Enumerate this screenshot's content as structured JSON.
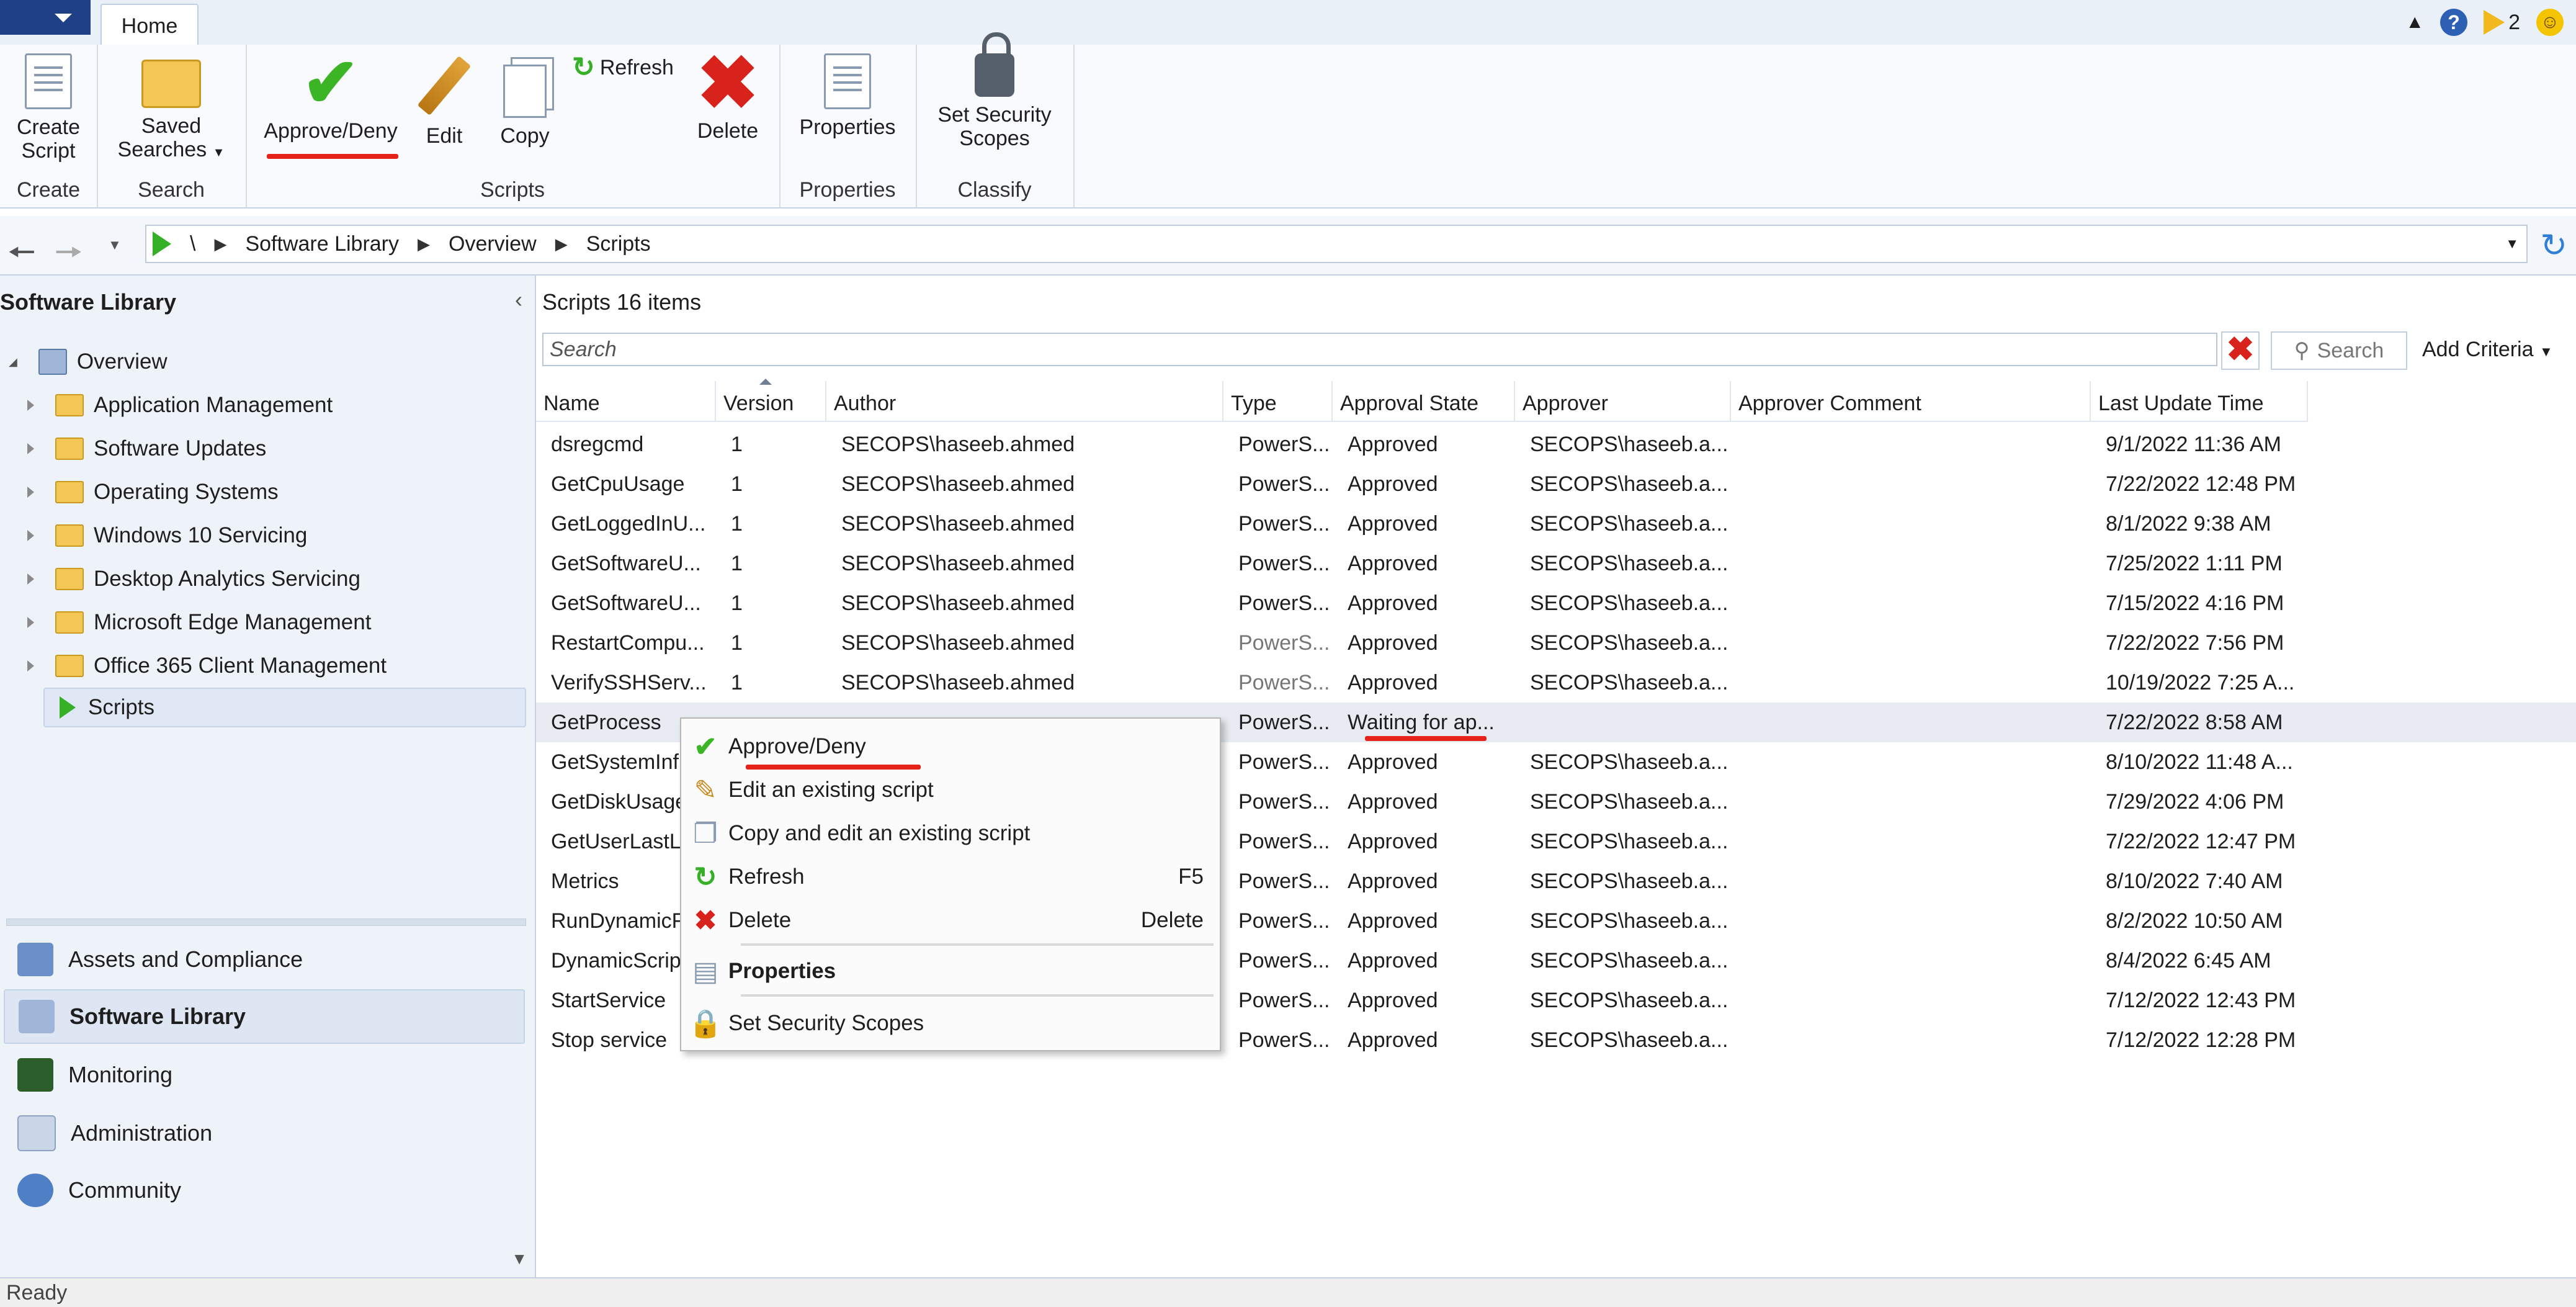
{
  "window": {
    "tab_home": "Home",
    "notification_count": "2",
    "help_glyph": "?"
  },
  "ribbon": {
    "create_script_line1": "Create",
    "create_script_line2": "Script",
    "saved_searches_line1": "Saved",
    "saved_searches_line2": "Searches",
    "approve_deny": "Approve/Deny",
    "edit": "Edit",
    "copy": "Copy",
    "refresh": "Refresh",
    "delete": "Delete",
    "properties": "Properties",
    "set_security_line1": "Set Security",
    "set_security_line2": "Scopes",
    "groups": {
      "create": "Create",
      "search": "Search",
      "scripts": "Scripts",
      "properties": "Properties",
      "classify": "Classify"
    }
  },
  "breadcrumb": {
    "root": "\\",
    "items": [
      "Software Library",
      "Overview",
      "Scripts"
    ]
  },
  "left_pane": {
    "title": "Software Library",
    "tree": [
      "Overview",
      "Application Management",
      "Software Updates",
      "Operating Systems",
      "Windows 10 Servicing",
      "Desktop Analytics Servicing",
      "Microsoft Edge Management",
      "Office 365 Client Management",
      "Scripts"
    ],
    "workspaces": [
      "Assets and Compliance",
      "Software Library",
      "Monitoring",
      "Administration",
      "Community"
    ]
  },
  "list": {
    "title": "Scripts 16 items",
    "search_placeholder": "Search",
    "search_button": "Search",
    "add_criteria": "Add Criteria",
    "columns": [
      "Name",
      "Version",
      "Author",
      "Type",
      "Approval State",
      "Approver",
      "Approver Comment",
      "Last Update Time"
    ],
    "rows": [
      [
        "dsregcmd",
        "1",
        "SECOPS\\haseeb.ahmed",
        "PowerS...",
        "Approved",
        "SECOPS\\haseeb.a...",
        "",
        "9/1/2022 11:36 AM"
      ],
      [
        "GetCpuUsage",
        "1",
        "SECOPS\\haseeb.ahmed",
        "PowerS...",
        "Approved",
        "SECOPS\\haseeb.a...",
        "",
        "7/22/2022 12:48 PM"
      ],
      [
        "GetLoggedInU...",
        "1",
        "SECOPS\\haseeb.ahmed",
        "PowerS...",
        "Approved",
        "SECOPS\\haseeb.a...",
        "",
        "8/1/2022 9:38 AM"
      ],
      [
        "GetSoftwareU...",
        "1",
        "SECOPS\\haseeb.ahmed",
        "PowerS...",
        "Approved",
        "SECOPS\\haseeb.a...",
        "",
        "7/25/2022 1:11 PM"
      ],
      [
        "GetSoftwareU...",
        "1",
        "SECOPS\\haseeb.ahmed",
        "PowerS...",
        "Approved",
        "SECOPS\\haseeb.a...",
        "",
        "7/15/2022 4:16 PM"
      ],
      [
        "RestartCompu...",
        "1",
        "SECOPS\\haseeb.ahmed",
        "PowerS...",
        "Approved",
        "SECOPS\\haseeb.a...",
        "",
        "7/22/2022 7:56 PM"
      ],
      [
        "VerifySSHServ...",
        "1",
        "SECOPS\\haseeb.ahmed",
        "PowerS...",
        "Approved",
        "SECOPS\\haseeb.a...",
        "",
        "10/19/2022 7:25 A..."
      ],
      [
        "GetProcess",
        "",
        "",
        "PowerS...",
        "Waiting for ap...",
        "",
        "",
        "7/22/2022 8:58 AM"
      ],
      [
        "GetSystemInf",
        "",
        "",
        "PowerS...",
        "Approved",
        "SECOPS\\haseeb.a...",
        "",
        "8/10/2022 11:48 A..."
      ],
      [
        "GetDiskUsage",
        "",
        "",
        "PowerS...",
        "Approved",
        "SECOPS\\haseeb.a...",
        "",
        "7/29/2022 4:06 PM"
      ],
      [
        "GetUserLastL",
        "",
        "",
        "PowerS...",
        "Approved",
        "SECOPS\\haseeb.a...",
        "",
        "7/22/2022 12:47 PM"
      ],
      [
        "Metrics",
        "",
        "",
        "PowerS...",
        "Approved",
        "SECOPS\\haseeb.a...",
        "",
        "8/10/2022 7:40 AM"
      ],
      [
        "RunDynamicF",
        "",
        "",
        "PowerS...",
        "Approved",
        "SECOPS\\haseeb.a...",
        "",
        "8/2/2022 10:50 AM"
      ],
      [
        "DynamicScrip",
        "",
        "",
        "PowerS...",
        "Approved",
        "SECOPS\\haseeb.a...",
        "",
        "8/4/2022 6:45 AM"
      ],
      [
        "StartService",
        "",
        "",
        "PowerS...",
        "Approved",
        "SECOPS\\haseeb.a...",
        "",
        "7/12/2022 12:43 PM"
      ],
      [
        "Stop service",
        "",
        "",
        "PowerS...",
        "Approved",
        "SECOPS\\haseeb.a...",
        "",
        "7/12/2022 12:28 PM"
      ]
    ]
  },
  "context_menu": {
    "items": [
      {
        "label": "Approve/Deny",
        "key": "",
        "icon": "check-icon"
      },
      {
        "label": "Edit an existing script",
        "key": "",
        "icon": "pencil-icon"
      },
      {
        "label": "Copy and edit an existing script",
        "key": "",
        "icon": "copy-icon"
      },
      {
        "label": "Refresh",
        "key": "F5",
        "icon": "refresh-icon"
      },
      {
        "label": "Delete",
        "key": "Delete",
        "icon": "delete-icon"
      },
      {
        "label": "Properties",
        "key": "",
        "icon": "properties-icon"
      },
      {
        "label": "Set Security Scopes",
        "key": "",
        "icon": "lock-icon"
      }
    ]
  },
  "status": {
    "text": "Ready"
  },
  "colors": {
    "accent_blue": "#1f3f86",
    "approve_green": "#3bb526",
    "delete_red": "#d8231d",
    "annotation_red": "#e5231b"
  }
}
